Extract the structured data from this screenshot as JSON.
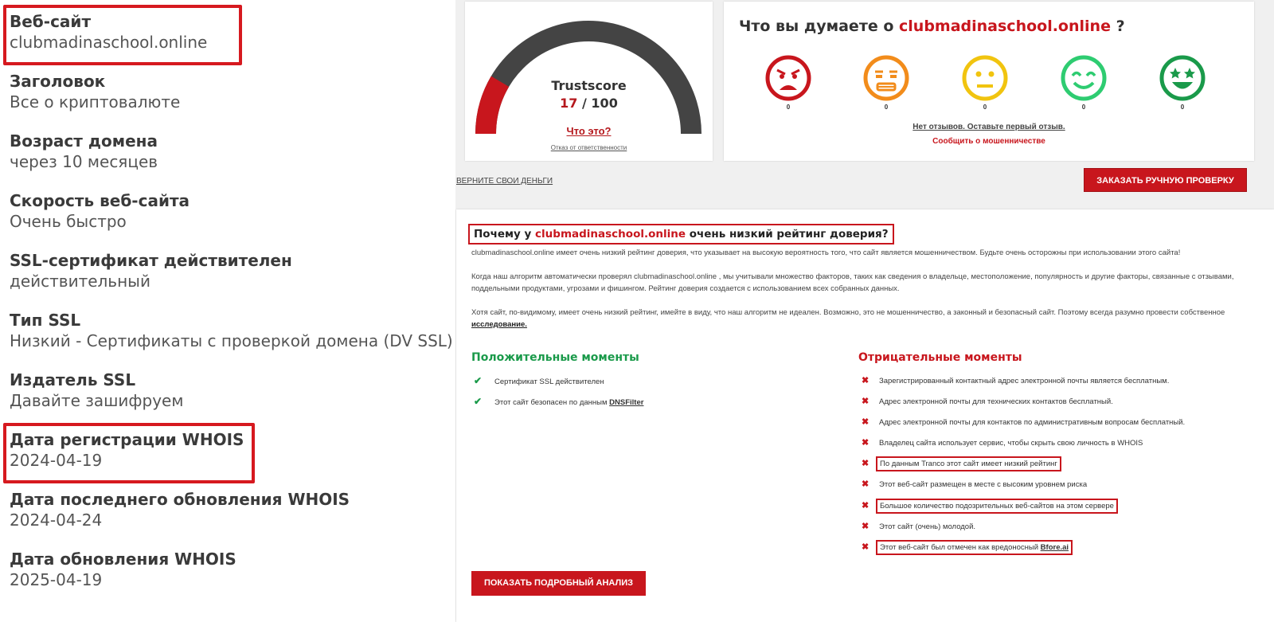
{
  "left_panel": {
    "items": [
      {
        "label": "Веб-сайт",
        "value": "clubmadinaschool.online"
      },
      {
        "label": "Заголовок",
        "value": "Все о криптовалюте"
      },
      {
        "label": "Возраст домена",
        "value": "через 10 месяцев"
      },
      {
        "label": "Скорость веб-сайта",
        "value": "Очень быстро"
      },
      {
        "label": "SSL-сертификат действителен",
        "value": "действительный"
      },
      {
        "label": "Тип SSL",
        "value": "Низкий - Сертификаты с проверкой домена (DV SSL)"
      },
      {
        "label": "Издатель SSL",
        "value": "Давайте зашифруем"
      },
      {
        "label": "Дата регистрации WHOIS",
        "value": "2024-04-19"
      },
      {
        "label": "Дата последнего обновления WHOIS",
        "value": "2024-04-24"
      },
      {
        "label": "Дата обновления WHOIS",
        "value": "2025-04-19"
      }
    ]
  },
  "trustscore": {
    "title": "Trustscore",
    "score": "17",
    "max": "100",
    "separator": "/",
    "level": 0.17,
    "what_link": "Что это?",
    "disclaimer": "Отказ от ответственности",
    "colors": {
      "low": "#c8161d",
      "track": "#444444"
    }
  },
  "reviews": {
    "question_prefix": "Что вы думаете о",
    "domain": "clubmadinaschool.online",
    "question_suffix": "?",
    "emojis": [
      {
        "icon": "angry-face-icon",
        "count": "0",
        "color": "#c8161d"
      },
      {
        "icon": "annoyed-face-icon",
        "count": "0",
        "color": "#f28c1b"
      },
      {
        "icon": "neutral-face-icon",
        "count": "0",
        "color": "#f1c40f"
      },
      {
        "icon": "smiling-face-icon",
        "count": "0",
        "color": "#2ecc71"
      },
      {
        "icon": "star-eyes-face-icon",
        "count": "0",
        "color": "#1a9a4a"
      }
    ],
    "no_reviews": "Нет отзывов. Оставьте первый отзыв.",
    "report_scam": "Сообщить о мошенничестве"
  },
  "actions": {
    "money_back": "ВЕРНИТЕ СВОИ ДЕНЬГИ",
    "order_review": "ЗАКАЗАТЬ РУЧНУЮ ПРОВЕРКУ",
    "show_analysis": "ПОКАЗАТЬ ПОДРОБНЫЙ АНАЛИЗ"
  },
  "analysis": {
    "why_prefix": "Почему у",
    "domain": "clubmadinaschool.online",
    "why_suffix": "очень низкий рейтинг доверия?",
    "p1": "clubmadinaschool.online имеет очень низкий рейтинг доверия, что указывает на высокую вероятность того, что сайт является мошенничеством. Будьте очень осторожны при использовании этого сайта!",
    "p2": "Когда наш алгоритм автоматически проверял clubmadinaschool.online , мы учитывали множество факторов, таких как сведения о владельце, местоположение, популярность и другие факторы, связанные с отзывами, поддельными продуктами, угрозами и фишингом. Рейтинг доверия создается с использованием всех собранных данных.",
    "p3": "Хотя сайт, по-видимому, имеет очень низкий рейтинг, имейте в виду, что наш алгоритм не идеален. Возможно, это не мошенничество, а законный и безопасный сайт. Поэтому всегда разумно провести собственное",
    "p3_link": "исследование.",
    "positives_title": "Положительные моменты",
    "positives": [
      {
        "text": "Сертификат SSL действителен",
        "link": ""
      },
      {
        "text": "Этот сайт безопасен по данным",
        "link": "DNSFilter"
      }
    ],
    "negatives_title": "Отрицательные моменты",
    "negatives": [
      {
        "text": "Зарегистрированный контактный адрес электронной почты является бесплатным.",
        "link": ""
      },
      {
        "text": "Адрес электронной почты для технических контактов бесплатный.",
        "link": ""
      },
      {
        "text": "Адрес электронной почты для контактов по административным вопросам бесплатный.",
        "link": ""
      },
      {
        "text": "Владелец сайта использует сервис, чтобы скрыть свою личность в WHOIS",
        "link": ""
      },
      {
        "text": "По данным Tranco этот сайт имеет низкий рейтинг",
        "link": ""
      },
      {
        "text": "Этот веб-сайт размещен в месте с высоким уровнем риска",
        "link": ""
      },
      {
        "text": "Большое количество подозрительных веб-сайтов на этом сервере",
        "link": ""
      },
      {
        "text": "Этот сайт (очень) молодой.",
        "link": ""
      },
      {
        "text": "Этот веб-сайт был отмечен как вредоносный",
        "link": "Bfore.ai"
      }
    ]
  }
}
